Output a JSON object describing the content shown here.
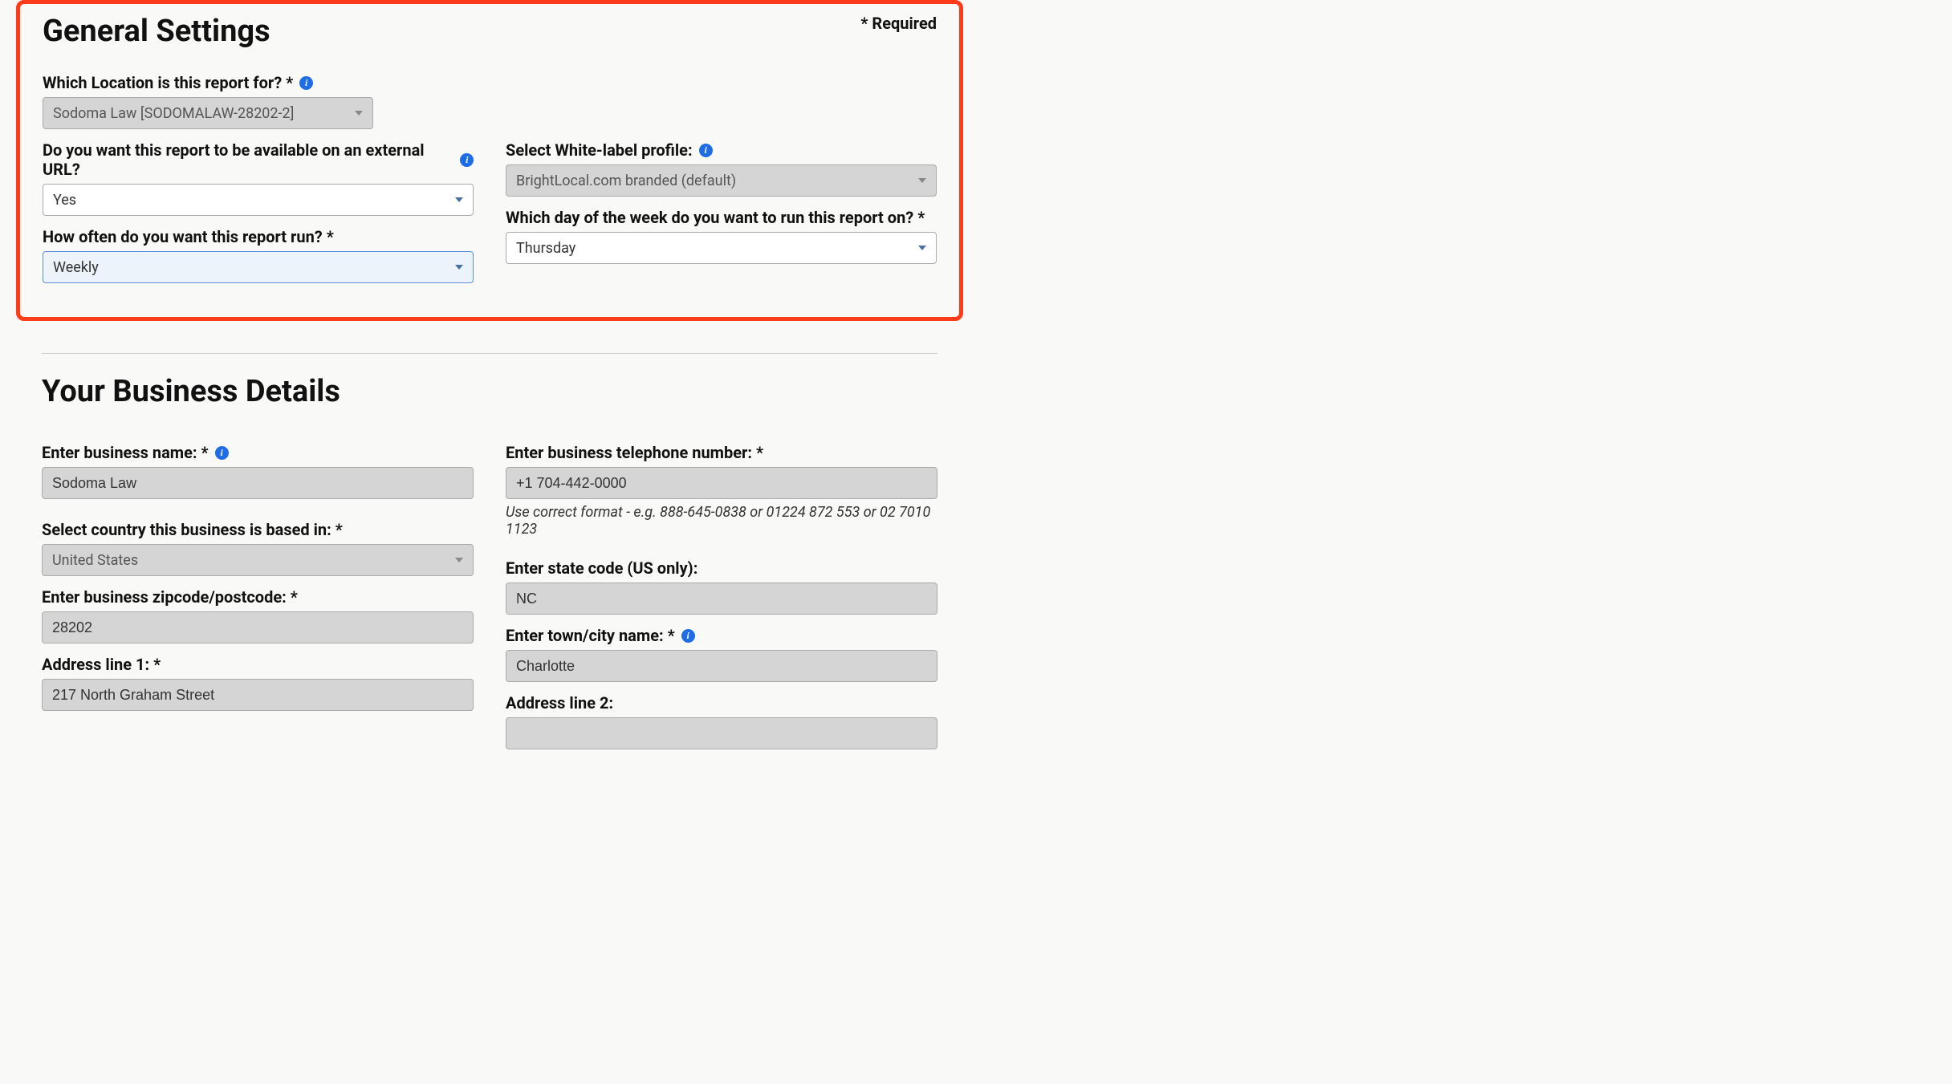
{
  "general": {
    "title": "General Settings",
    "required_label": "*  Required",
    "location": {
      "label": "Which Location is this report for? *",
      "value": "Sodoma Law [SODOMALAW-28202-2]"
    },
    "external_url": {
      "label": "Do you want this report to be available on an external URL?",
      "value": "Yes"
    },
    "white_label": {
      "label": "Select White-label profile:",
      "value": "BrightLocal.com branded (default)"
    },
    "frequency": {
      "label": "How often do you want this report run? *",
      "value": "Weekly"
    },
    "day": {
      "label": "Which day of the week do you want to run this report on? *",
      "value": "Thursday"
    }
  },
  "business": {
    "title": "Your Business Details",
    "name": {
      "label": "Enter business name: *",
      "value": "Sodoma Law"
    },
    "phone": {
      "label": "Enter business telephone number: *",
      "value": "+1 704-442-0000",
      "hint": "Use correct format - e.g. 888-645-0838 or 01224 872 553 or 02 7010 1123"
    },
    "country": {
      "label": "Select country this business is based in: *",
      "value": "United States"
    },
    "state": {
      "label": "Enter state code (US only):",
      "value": "NC"
    },
    "zip": {
      "label": "Enter business zipcode/postcode: *",
      "value": "28202"
    },
    "city": {
      "label": "Enter town/city name: *",
      "value": "Charlotte"
    },
    "address1": {
      "label": "Address line 1: *",
      "value": "217 North Graham Street"
    },
    "address2": {
      "label": "Address line 2:",
      "value": ""
    }
  }
}
